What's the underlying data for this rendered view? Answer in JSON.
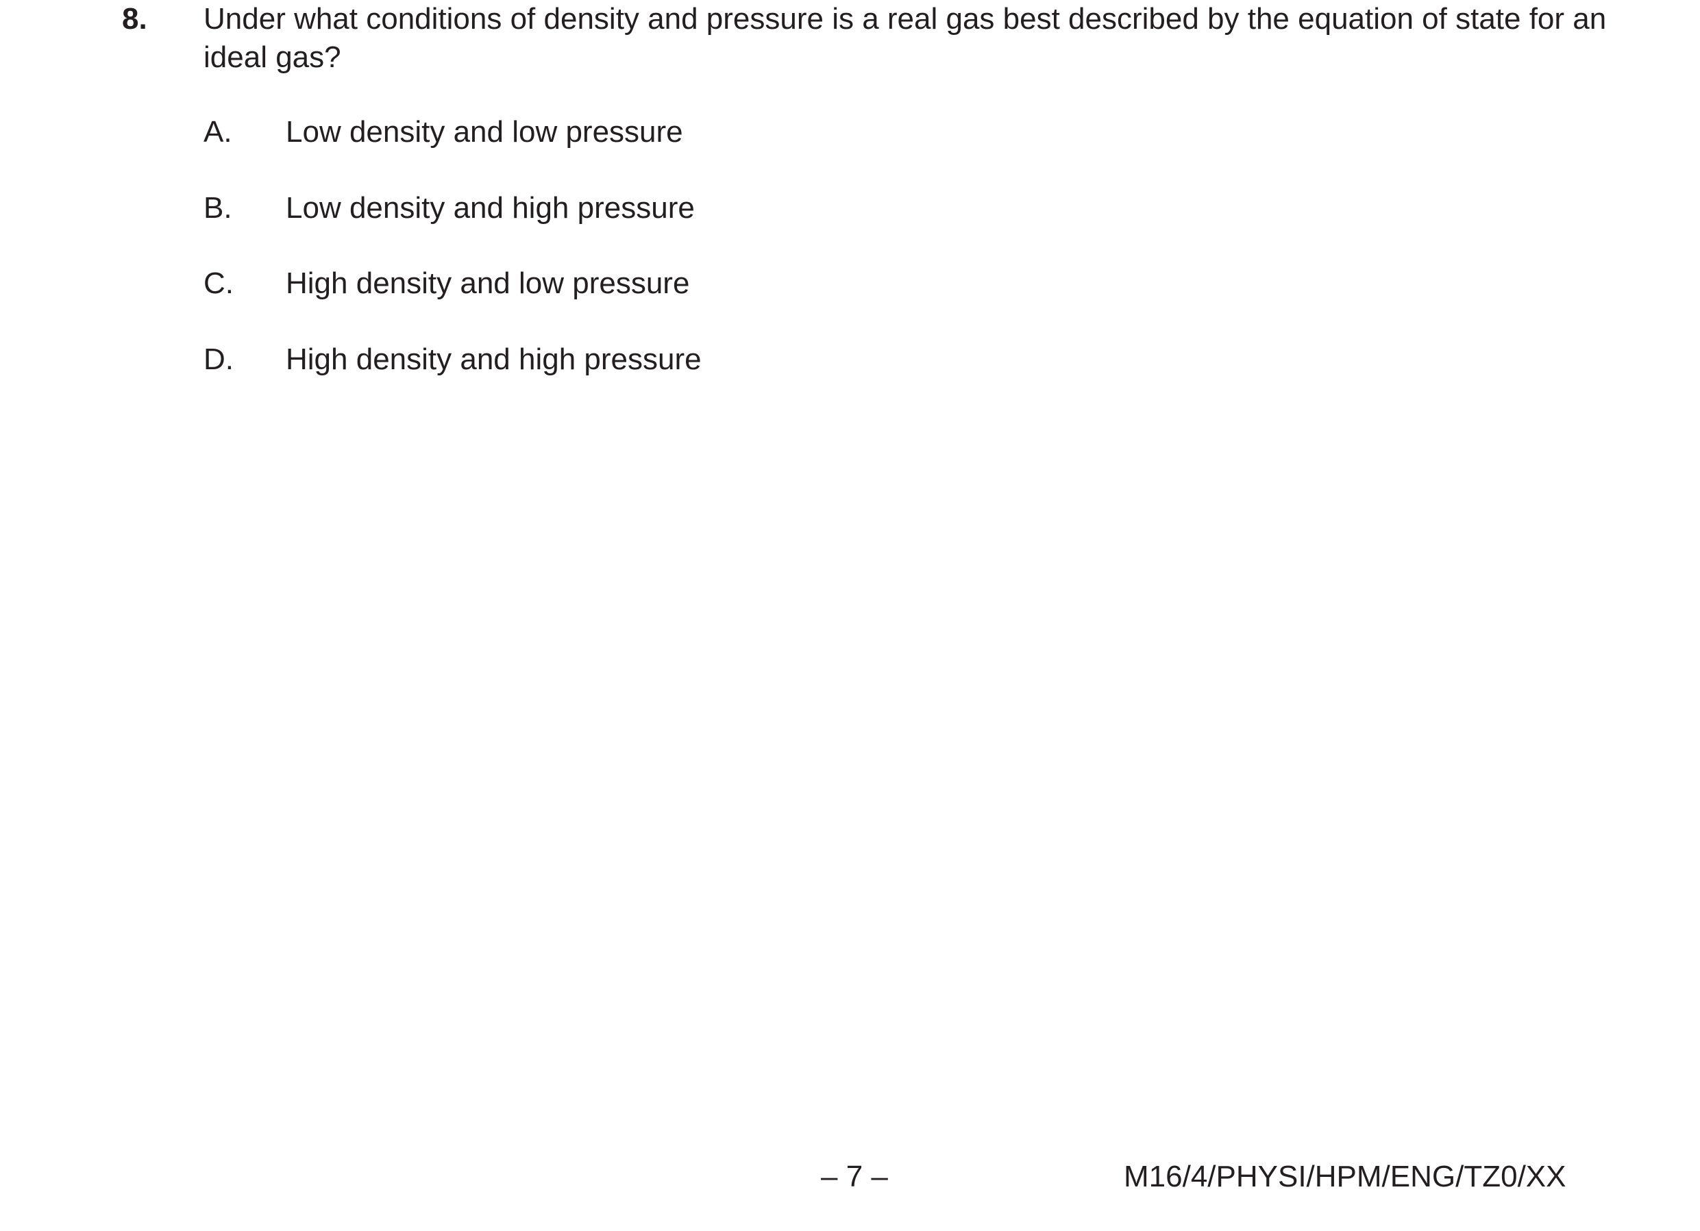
{
  "question": {
    "number": "8.",
    "stem": "Under what conditions of density and pressure is a real gas best described by the equation of state for an ideal gas?",
    "options": [
      {
        "letter": "A.",
        "text": "Low density and low pressure"
      },
      {
        "letter": "B.",
        "text": "Low density and high pressure"
      },
      {
        "letter": "C.",
        "text": "High density and low pressure"
      },
      {
        "letter": "D.",
        "text": "High density and high pressure"
      }
    ]
  },
  "footer": {
    "page_number": "– 7 –",
    "paper_code": "M16/4/PHYSI/HPM/ENG/TZ0/XX"
  }
}
